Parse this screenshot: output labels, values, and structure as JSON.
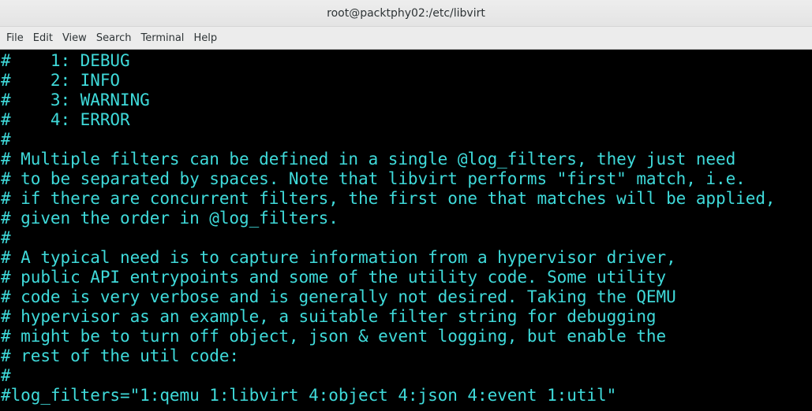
{
  "window": {
    "title": "root@packtphy02:/etc/libvirt"
  },
  "menu": {
    "items": [
      "File",
      "Edit",
      "View",
      "Search",
      "Terminal",
      "Help"
    ]
  },
  "terminal": {
    "text_color": "#3fdada",
    "background": "#000000",
    "lines": [
      "#    1: DEBUG",
      "#    2: INFO",
      "#    3: WARNING",
      "#    4: ERROR",
      "#",
      "# Multiple filters can be defined in a single @log_filters, they just need",
      "# to be separated by spaces. Note that libvirt performs \"first\" match, i.e.",
      "# if there are concurrent filters, the first one that matches will be applied,",
      "# given the order in @log_filters.",
      "#",
      "# A typical need is to capture information from a hypervisor driver,",
      "# public API entrypoints and some of the utility code. Some utility",
      "# code is very verbose and is generally not desired. Taking the QEMU",
      "# hypervisor as an example, a suitable filter string for debugging",
      "# might be to turn off object, json & event logging, but enable the",
      "# rest of the util code:",
      "#",
      "#log_filters=\"1:qemu 1:libvirt 4:object 4:json 4:event 1:util\""
    ]
  }
}
